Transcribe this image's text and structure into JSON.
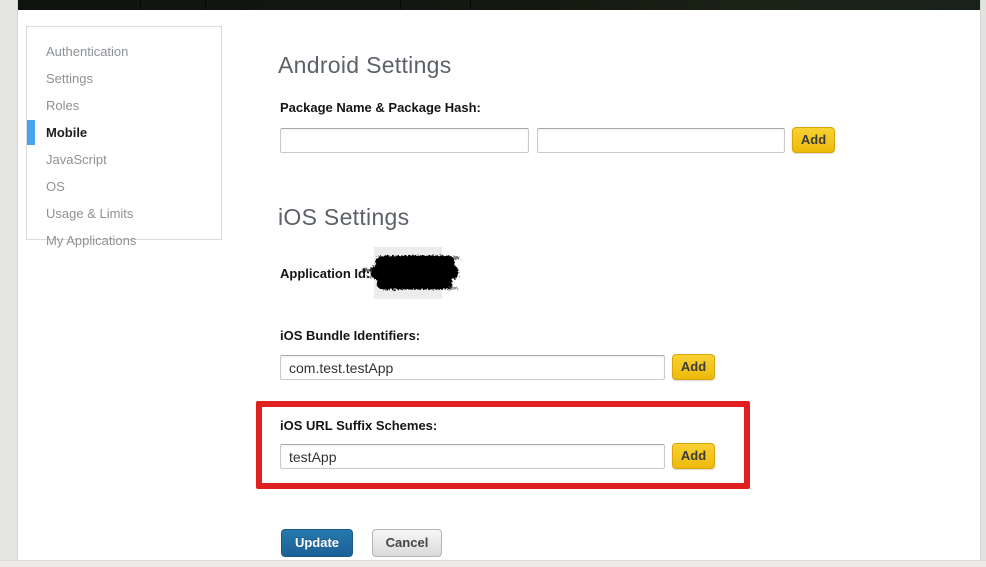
{
  "sidebar": {
    "items": [
      {
        "label": "Authentication",
        "active": false
      },
      {
        "label": "Settings",
        "active": false
      },
      {
        "label": "Roles",
        "active": false
      },
      {
        "label": "Mobile",
        "active": true
      },
      {
        "label": "JavaScript",
        "active": false
      },
      {
        "label": "OS",
        "active": false
      },
      {
        "label": "Usage & Limits",
        "active": false
      },
      {
        "label": "My Applications",
        "active": false
      }
    ]
  },
  "android": {
    "title": "Android Settings",
    "package_label": "Package Name & Package Hash:",
    "package_name_value": "",
    "package_hash_value": "",
    "add_label": "Add"
  },
  "ios": {
    "title": "iOS Settings",
    "application_id_label": "Application Id:",
    "bundle_label": "iOS Bundle Identifiers:",
    "bundle_value": "com.test.testApp",
    "bundle_add_label": "Add",
    "suffix_label": "iOS URL Suffix Schemes:",
    "suffix_value": "testApp",
    "suffix_add_label": "Add"
  },
  "actions": {
    "update_label": "Update",
    "cancel_label": "Cancel"
  },
  "colors": {
    "active_marker_blue": "#47a2f0",
    "add_button_yellow": "#f0c114",
    "update_button_blue": "#21689e",
    "annotation_red": "#e01f1f"
  }
}
